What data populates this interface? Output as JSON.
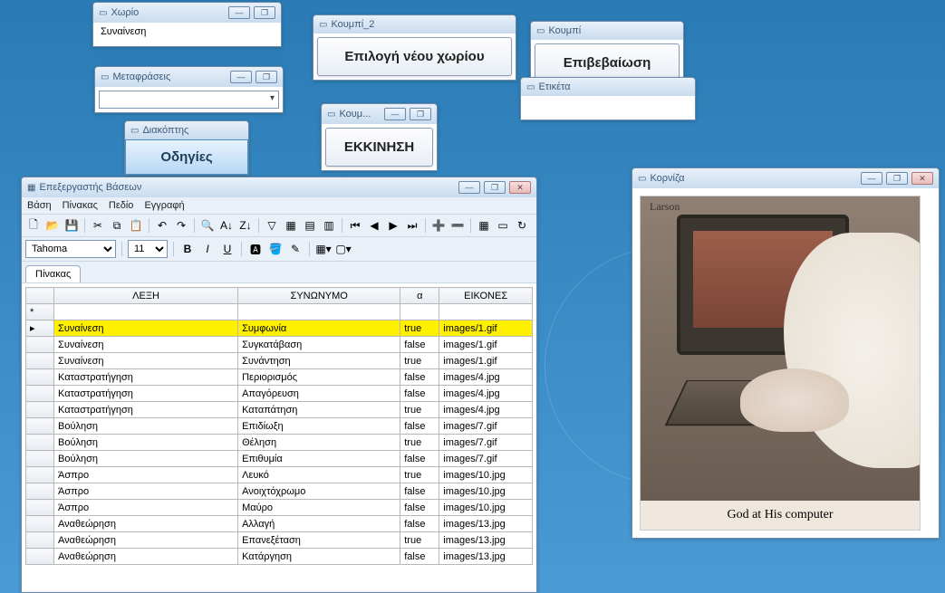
{
  "windows": {
    "xorio": {
      "title": "Χωρίο",
      "value": "Συναίνεση"
    },
    "metafraseis": {
      "title": "Μεταφράσεις"
    },
    "diakoptis": {
      "title": "Διακόπτης",
      "btn": "Οδηγίες"
    },
    "koum": {
      "title": "Κουμ...",
      "btn": "ΕΚΚΙΝΗΣΗ"
    },
    "koumpi2": {
      "title": "Κουμπί_2",
      "btn": "Επιλογή νέου χωρίου"
    },
    "koumpi": {
      "title": "Κουμπί",
      "btn": "Επιβεβαίωση"
    },
    "etiketa": {
      "title": "Ετικέτα"
    },
    "korniza": {
      "title": "Κορνίζα",
      "caption": "God at His computer",
      "signature": "Larson"
    }
  },
  "db": {
    "title": "Επεξεργαστής Βάσεων",
    "menu": [
      "Βάση",
      "Πίνακας",
      "Πεδίο",
      "Εγγραφή"
    ],
    "font": "Tahoma",
    "size": "11",
    "tab": "Πίνακας",
    "columns": [
      "",
      "ΛΕΞΗ",
      "ΣΥΝΩΝΥΜΟ",
      "α",
      "ΕΙΚΟΝΕΣ"
    ],
    "star": "*",
    "rows": [
      {
        "lex": "Συναίνεση",
        "syn": "Συμφωνία",
        "a": "true",
        "img": "images/1.gif",
        "sel": true
      },
      {
        "lex": "Συναίνεση",
        "syn": "Συγκατάβαση",
        "a": "false",
        "img": "images/1.gif"
      },
      {
        "lex": "Συναίνεση",
        "syn": "Συνάντηση",
        "a": "true",
        "img": "images/1.gif"
      },
      {
        "lex": "Καταστρατήγηση",
        "syn": "Περιορισμός",
        "a": "false",
        "img": "images/4.jpg"
      },
      {
        "lex": "Καταστρατήγηση",
        "syn": "Απαγόρευση",
        "a": "false",
        "img": "images/4.jpg"
      },
      {
        "lex": "Καταστρατήγηση",
        "syn": "Καταπάτηση",
        "a": "true",
        "img": "images/4.jpg"
      },
      {
        "lex": "Βούληση",
        "syn": "Επιδίωξη",
        "a": "false",
        "img": "images/7.gif"
      },
      {
        "lex": "Βούληση",
        "syn": "Θέληση",
        "a": "true",
        "img": "images/7.gif"
      },
      {
        "lex": "Βούληση",
        "syn": "Επιθυμία",
        "a": "false",
        "img": "images/7.gif"
      },
      {
        "lex": "Άσπρο",
        "syn": "Λευκό",
        "a": "true",
        "img": "images/10.jpg"
      },
      {
        "lex": "Άσπρο",
        "syn": "Ανοιχτόχρωμο",
        "a": "false",
        "img": "images/10.jpg"
      },
      {
        "lex": "Άσπρο",
        "syn": "Μαύρο",
        "a": "false",
        "img": "images/10.jpg"
      },
      {
        "lex": "Αναθεώρηση",
        "syn": "Αλλαγή",
        "a": "false",
        "img": "images/13.jpg"
      },
      {
        "lex": "Αναθεώρηση",
        "syn": "Επανεξέταση",
        "a": "true",
        "img": "images/13.jpg"
      },
      {
        "lex": "Αναθεώρηση",
        "syn": "Κατάργηση",
        "a": "false",
        "img": "images/13.jpg"
      }
    ]
  },
  "ctrl": {
    "min": "—",
    "max": "❐",
    "close": "✕",
    "arrow": "▸"
  }
}
